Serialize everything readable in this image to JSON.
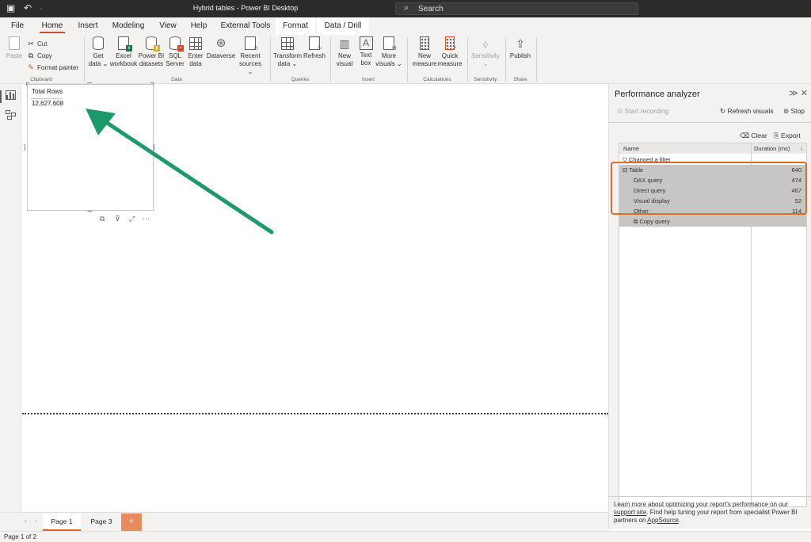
{
  "titlebar": {
    "title": "Hybrid tables - Power BI Desktop",
    "search_placeholder": "Search",
    "quick_access": [
      "save-icon",
      "undo-icon",
      "redo-icon"
    ]
  },
  "menu": {
    "tabs": [
      "File",
      "Home",
      "Insert",
      "Modeling",
      "View",
      "Help",
      "External Tools",
      "Format",
      "Data / Drill"
    ],
    "active": "Home"
  },
  "ribbon": {
    "clipboard": {
      "paste": "Paste",
      "cut": "Cut",
      "copy": "Copy",
      "format_painter": "Format painter",
      "group": "Clipboard"
    },
    "data": {
      "get_data": [
        "Get",
        "data ⌄"
      ],
      "excel": [
        "Excel",
        "workbook"
      ],
      "powerbi": [
        "Power BI",
        "datasets"
      ],
      "sql": [
        "SQL",
        "Server"
      ],
      "enter": [
        "Enter",
        "data"
      ],
      "dataverse": [
        "Dataverse",
        ""
      ],
      "recent": [
        "Recent",
        "sources ⌄"
      ],
      "group": "Data"
    },
    "queries": {
      "transform": [
        "Transform",
        "data ⌄"
      ],
      "refresh": [
        "Refresh",
        ""
      ],
      "group": "Queries"
    },
    "insert": {
      "new_visual": [
        "New",
        "visual"
      ],
      "text_box": [
        "Text",
        "box"
      ],
      "more_visuals": [
        "More",
        "visuals ⌄"
      ],
      "group": "Insert"
    },
    "calculations": {
      "new_measure": [
        "New",
        "measure"
      ],
      "quick_measure": [
        "Quick",
        "measure"
      ],
      "group": "Calculations"
    },
    "sensitivity": {
      "label": [
        "Sensitivity",
        "⌄"
      ],
      "group": "Sensitivity"
    },
    "share": {
      "publish": [
        "Publish",
        ""
      ],
      "group": "Share"
    }
  },
  "visual": {
    "title": "Total Rows",
    "value": "12,627,608"
  },
  "pane": {
    "title": "Performance analyzer",
    "start_recording": "Start recording",
    "refresh_visuals": "Refresh visuals",
    "stop": "Stop",
    "clear": "Clear",
    "export": "Export",
    "col_name": "Name",
    "col_duration": "Duration (ms)",
    "rows": [
      {
        "name": "Changed a filter",
        "duration": ""
      },
      {
        "name": "Table",
        "duration": "640"
      },
      {
        "name": "DAX query",
        "duration": "474"
      },
      {
        "name": "Direct query",
        "duration": "467"
      },
      {
        "name": "Visual display",
        "duration": "52"
      },
      {
        "name": "Other",
        "duration": "114"
      },
      {
        "name": "Copy query",
        "duration": ""
      }
    ],
    "footer_1": "Learn more about optimizing your report's performance on our ",
    "footer_link1": "support site",
    "footer_2": ". Find help tuning your report from specialist Power BI partners on ",
    "footer_link2": "AppSource",
    "footer_3": "."
  },
  "pages": {
    "tabs": [
      "Page 1",
      "Page 3"
    ],
    "active": "Page 1",
    "add": "+"
  },
  "status": {
    "text": "Page 1 of 2"
  },
  "colors": {
    "accent": "#e06a2b",
    "arrow": "#1d9a6c",
    "titlebar": "#2b2b2b"
  }
}
